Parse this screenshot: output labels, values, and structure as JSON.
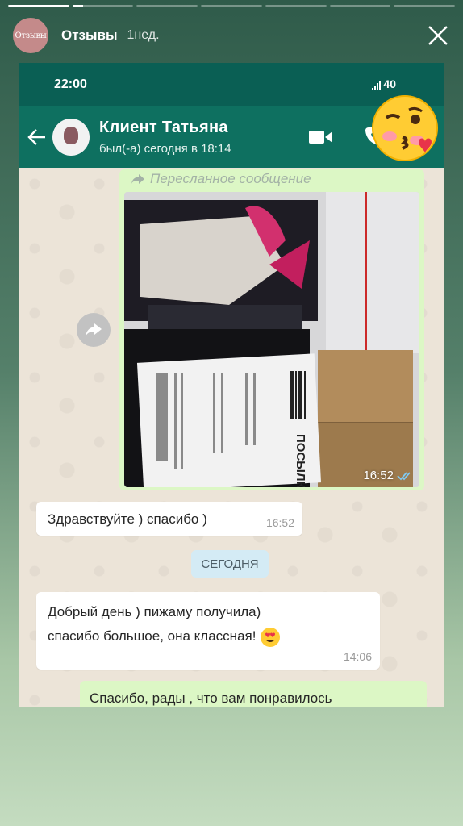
{
  "story": {
    "title": "Отзывы",
    "time": "1нед.",
    "avatar_text": "Отзывы",
    "progress": [
      1,
      0.18,
      0,
      0,
      0,
      0,
      0
    ]
  },
  "chat_screenshot": {
    "status_time": "22:00",
    "status_signal": "40",
    "contact_name": "Клиент Татьяна",
    "contact_status": "был(-а) сегодня в 18:14",
    "forwarded_label": "Пересланное сообщение",
    "photo_time": "16:52",
    "messages": [
      {
        "text": "Здравствуйте ) спасибо )",
        "time": "16:52"
      },
      {
        "line1": "Добрый день ) пижаму получила)",
        "line2": "спасибо большое, она классная!",
        "time": "14:06"
      }
    ],
    "date_chip": "СЕГОДНЯ",
    "reply_text": "Спасибо, рады , что вам понравилось",
    "parcel_label": "ПОСЫЛКА"
  },
  "colors": {
    "whatsapp_header": "#0e7060",
    "outgoing_bubble": "#dcf7c5",
    "incoming_bubble": "#ffffff"
  }
}
